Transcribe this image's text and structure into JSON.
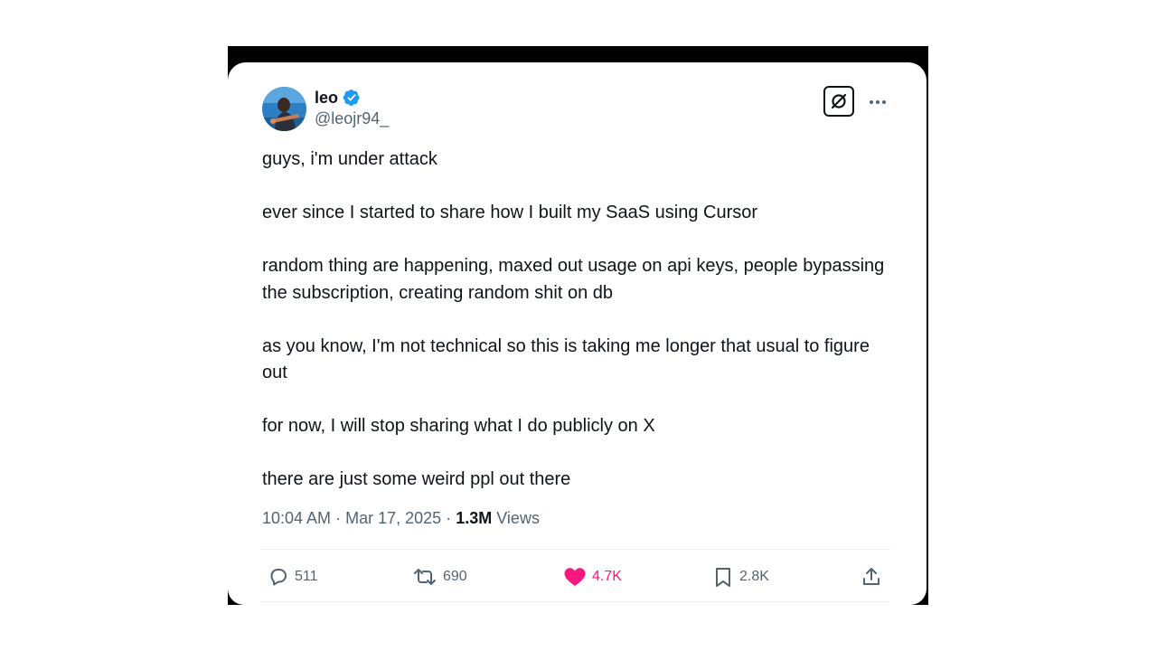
{
  "tweet": {
    "author": {
      "name": "leo",
      "handle": "@leojr94_",
      "verified": true
    },
    "paragraphs": [
      "guys, i'm under attack",
      "ever since I started to share how I built my SaaS using Cursor",
      "random thing are happening, maxed out usage on api keys, people bypassing the subscription, creating random shit on db",
      "as you know, I'm not technical so this is taking me longer that usual to figure out",
      "for now, I will stop sharing what I do publicly on X",
      "there are just some weird ppl out there"
    ],
    "time": "10:04 AM",
    "separator": "·",
    "date": "Mar 17, 2025",
    "views_count": "1.3M",
    "views_label": "Views"
  },
  "actions": {
    "replies": "511",
    "reposts": "690",
    "likes": "4.7K",
    "bookmarks": "2.8K"
  },
  "icons": {
    "verified": "verified-badge-icon",
    "grok": "grok-icon",
    "more": "more-options-icon",
    "reply": "reply-icon",
    "repost": "repost-icon",
    "like": "heart-icon",
    "bookmark": "bookmark-icon",
    "share": "share-icon"
  },
  "colors": {
    "verified": "#1d9bf0",
    "like": "#f91880",
    "text": "#0f1419",
    "secondary": "#536471"
  }
}
